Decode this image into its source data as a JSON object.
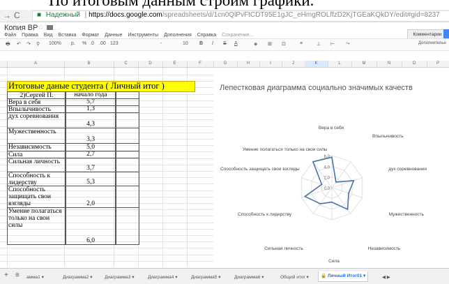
{
  "caption": "По итоговым данным строим графики.",
  "browser": {
    "secure_label": "Надежный",
    "url_host": "https://docs.google.com",
    "url_path": "/spreadsheets/d/1cn0QlPvFtCDT95E1gJC_eHmgROLffzD2KjTGEaKQkDY/edit#gid=8237"
  },
  "doc": {
    "title": "Копия ВР",
    "comments_label": "Комментарии",
    "menu": [
      "Файл",
      "Правка",
      "Вид",
      "Вставка",
      "Формат",
      "Данные",
      "Инструменты",
      "Дополнения",
      "Справка"
    ],
    "saved_text": "Сохранение..."
  },
  "toolbar": {
    "zoom": "100%",
    "currency": "р.",
    "percent": "%",
    "dec_less": ".0",
    "dec_more": ".00",
    "number_format": "123",
    "font_size": "10",
    "bold": "B",
    "italic": "I",
    "strike": "S",
    "text_color": "A",
    "more_label": "Дополнительн"
  },
  "columns": [
    "A",
    "B",
    "C",
    "D",
    "E",
    "F",
    "G",
    "H",
    "I",
    "J",
    "K",
    "L",
    "M",
    "N",
    "O",
    "P"
  ],
  "sheet": {
    "title": "Итоговые даные студента ( Личный итог )",
    "header": {
      "name": "2)Сергей П.",
      "value": "начало года"
    },
    "rows": [
      {
        "label": "Вера в себя",
        "value": "5,7"
      },
      {
        "label": "Впылычивость",
        "value": "1,3"
      },
      {
        "label": "дух соревнования",
        "value": "4,3"
      },
      {
        "label": "Мужественность",
        "value": "3,3"
      },
      {
        "label": "Независимость",
        "value": "5,0"
      },
      {
        "label": "Сила",
        "value": "2,7"
      },
      {
        "label": "Сильная личность",
        "value": "3,7"
      },
      {
        "label": "Способность к лидерству",
        "value": "5,3"
      },
      {
        "label": "Способность защищать свои взгляды",
        "value": "2,0"
      },
      {
        "label": "Умение полагаться только на свои силы",
        "value": "6,0"
      }
    ]
  },
  "chart_data": {
    "type": "radar",
    "title": "Лепестковая диаграмма социально значимых качеств",
    "categories": [
      "Вера в себя",
      "Впылычивость",
      "дух соревнования",
      "Мужественность",
      "Независимость",
      "Сила",
      "Сильная личность",
      "Способность к лидерству",
      "Способность защищать свои взгляды",
      "Умение полагаться только на свои силы"
    ],
    "values": [
      5.7,
      1.3,
      4.3,
      3.3,
      5.0,
      2.7,
      3.7,
      5.3,
      2.0,
      6.0
    ],
    "ticks": [
      "0,0",
      "2,0",
      "4,0",
      "6,0"
    ],
    "rmax": 6,
    "line_color": "#4a74a8",
    "grid": true
  },
  "tabs": [
    "амма1",
    "Диаграмма2",
    "Диаграмма3",
    "Диаграмма4",
    "Диаграмма5",
    "Диаграмма6",
    "Общий итог",
    "Личный Итог01"
  ],
  "colors": {
    "title_fill": "#ffff00",
    "accent": "#1a73e8",
    "secure": "#188038"
  }
}
